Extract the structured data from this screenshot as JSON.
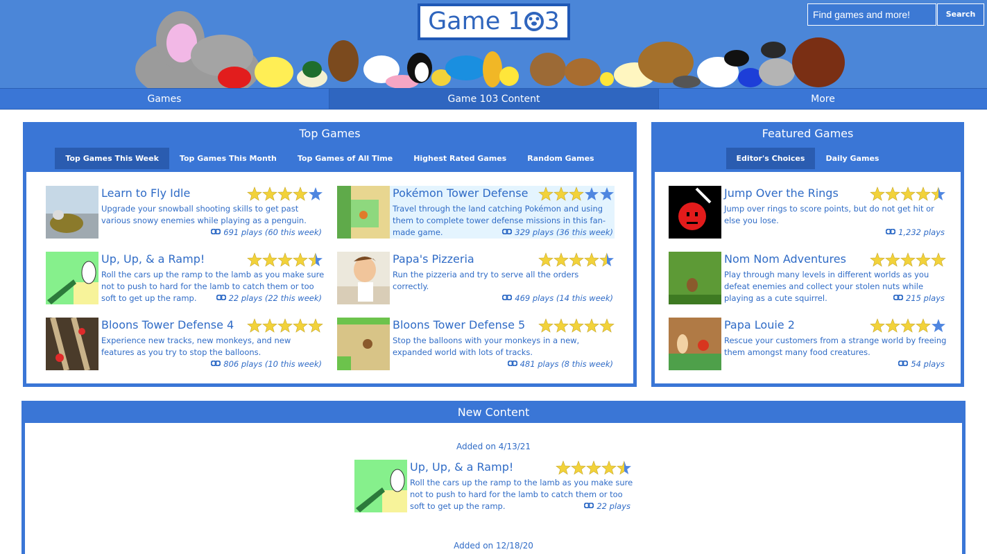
{
  "header": {
    "logo_text": "Game 1",
    "logo_text_end": "3",
    "search_placeholder": "Find games and more!",
    "search_button": "Search"
  },
  "nav": {
    "items": [
      {
        "label": "Games"
      },
      {
        "label": "Game 103 Content"
      },
      {
        "label": "More"
      }
    ]
  },
  "top_games": {
    "title": "Top Games",
    "tabs": [
      {
        "label": "Top Games This Week",
        "active": true
      },
      {
        "label": "Top Games This Month"
      },
      {
        "label": "Top Games of All Time"
      },
      {
        "label": "Highest Rated Games"
      },
      {
        "label": "Random Games"
      }
    ],
    "games": [
      {
        "title": "Learn to Fly Idle",
        "desc": "Upgrade your snowball shooting skills to get past various snowy enemies while playing as a penguin.",
        "plays": "691 plays (60 this week)",
        "rating": 4
      },
      {
        "title": "Pokémon Tower Defense",
        "desc": "Travel through the land catching Pokémon and using them to complete tower defense missions in this fan-made game.",
        "plays": "329 plays (36 this week)",
        "rating": 3
      },
      {
        "title": "Up, Up, & a Ramp!",
        "desc": "Roll the cars up the ramp to the lamb as you make sure not to push to hard for the lamb to catch them or too soft to get up the ramp.",
        "plays": "22 plays (22 this week)",
        "rating": 4.5
      },
      {
        "title": "Papa's Pizzeria",
        "desc": "Run the pizzeria and try to serve all the orders correctly.",
        "plays": "469 plays (14 this week)",
        "rating": 4.5
      },
      {
        "title": "Bloons Tower Defense 4",
        "desc": "Experience new tracks, new monkeys, and new features as you try to stop the balloons.",
        "plays": "806 plays (10 this week)",
        "rating": 5
      },
      {
        "title": "Bloons Tower Defense 5",
        "desc": "Stop the balloons with your monkeys in a new, expanded world with lots of tracks.",
        "plays": "481 plays (8 this week)",
        "rating": 5
      }
    ]
  },
  "featured_games": {
    "title": "Featured Games",
    "tabs": [
      {
        "label": "Editor's Choices",
        "active": true
      },
      {
        "label": "Daily Games"
      }
    ],
    "games": [
      {
        "title": "Jump Over the Rings",
        "desc": "Jump over rings to score points, but do not get hit or else you lose.",
        "plays": "1,232 plays",
        "rating": 4.5
      },
      {
        "title": "Nom Nom Adventures",
        "desc": "Play through many levels in different worlds as you defeat enemies and collect your stolen nuts while playing as a cute squirrel.",
        "plays": "215 plays",
        "rating": 5
      },
      {
        "title": "Papa Louie 2",
        "desc": "Rescue your customers from a strange world by freeing them amongst many food creatures.",
        "plays": "54 plays",
        "rating": 4
      }
    ]
  },
  "new_content": {
    "title": "New Content",
    "entries": [
      {
        "added": "Added on 4/13/21",
        "game": {
          "title": "Up, Up, & a Ramp!",
          "desc": "Roll the cars up the ramp to the lamb as you make sure not to push to hard for the lamb to catch them or too soft to get up the ramp.",
          "plays": "22 plays",
          "rating": 4.5
        }
      },
      {
        "added": "Added on 12/18/20"
      }
    ]
  },
  "colors": {
    "brand_blue": "#3a76d6",
    "link_blue": "#2f6bc6",
    "star_gold": "#f2d23a",
    "star_empty": "#4f86e0",
    "highlight": "#e4f4fe"
  }
}
